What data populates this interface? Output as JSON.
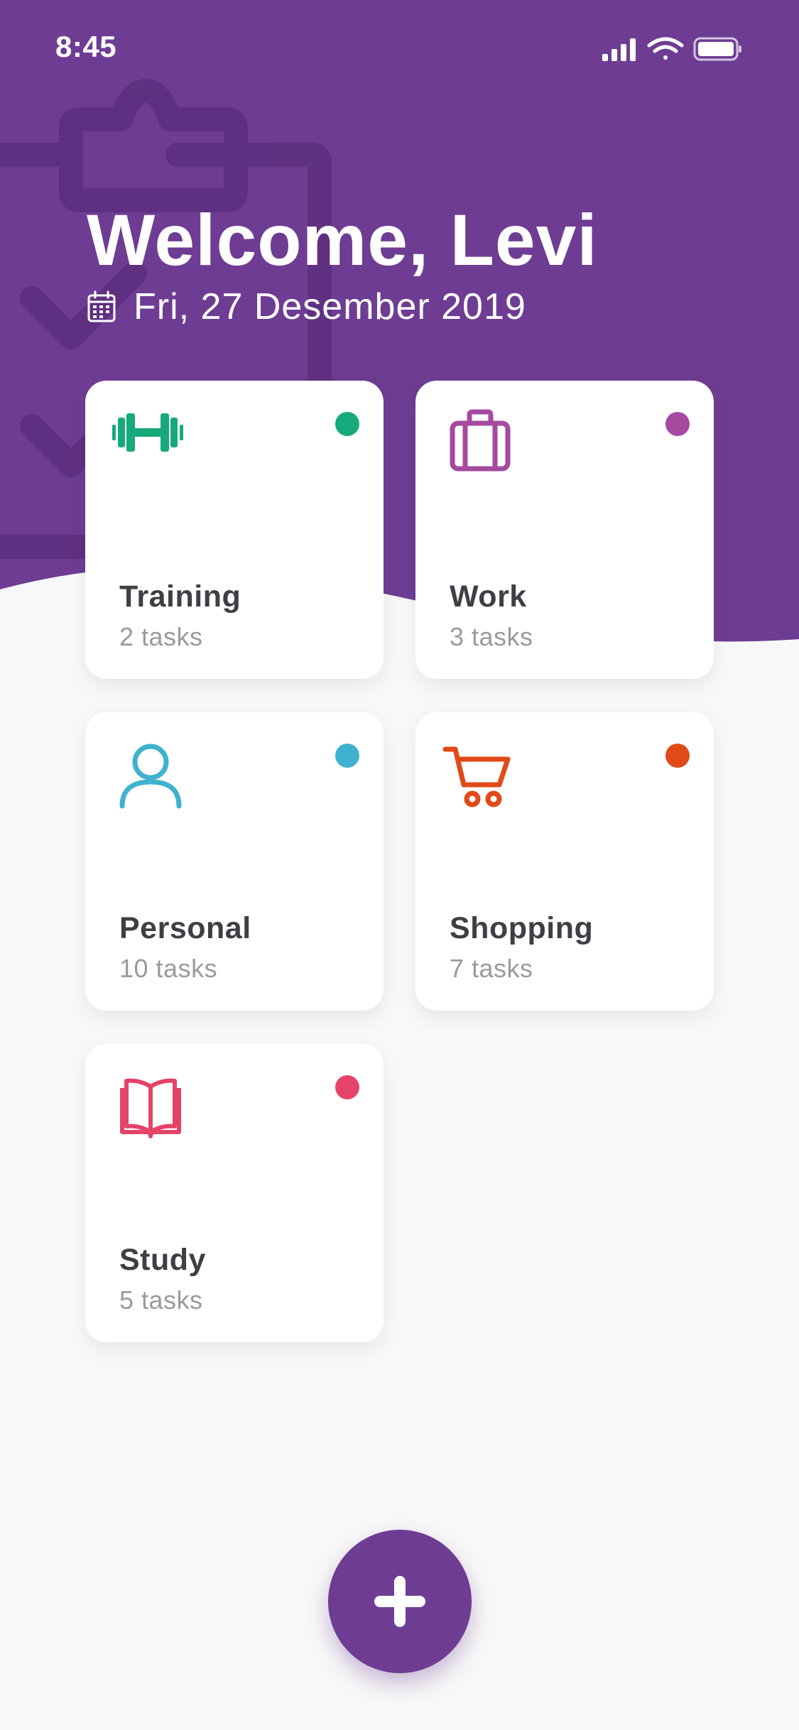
{
  "colors": {
    "brand": "#6e3d93",
    "background": "#f8f8f8",
    "card": "#ffffff"
  },
  "status_bar": {
    "time": "8:45",
    "icons": [
      "signal-icon",
      "wifi-icon",
      "battery-icon"
    ]
  },
  "header": {
    "greeting": "Welcome, Levi",
    "date": "Fri, 27 Desember 2019",
    "date_icon": "calendar-icon"
  },
  "categories": [
    {
      "title": "Training",
      "count": "2 tasks",
      "icon": "dumbbell-icon",
      "color": "#16a97b"
    },
    {
      "title": "Work",
      "count": "3 tasks",
      "icon": "briefcase-icon",
      "color": "#a54aa0"
    },
    {
      "title": "Personal",
      "count": "10 tasks",
      "icon": "person-icon",
      "color": "#3fb2d0"
    },
    {
      "title": "Shopping",
      "count": "7 tasks",
      "icon": "cart-icon",
      "color": "#e14a17"
    },
    {
      "title": "Study",
      "count": "5 tasks",
      "icon": "book-icon",
      "color": "#e54367"
    }
  ],
  "fab": {
    "icon": "plus-icon"
  }
}
